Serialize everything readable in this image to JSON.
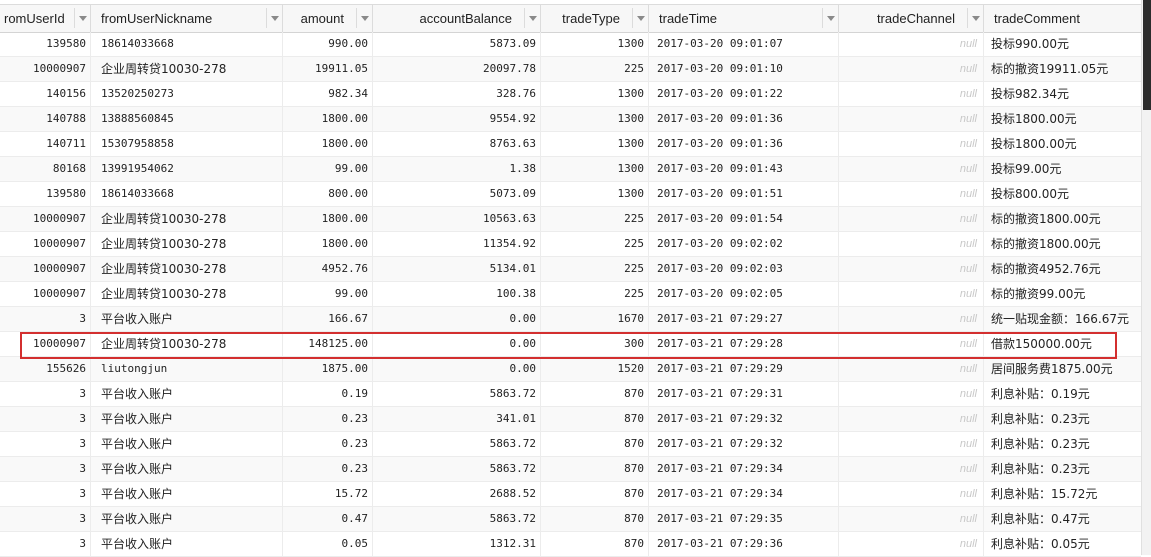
{
  "columns": [
    {
      "key": "fromUserId",
      "label": "romUserId"
    },
    {
      "key": "fromUserNickname",
      "label": "fromUserNickname"
    },
    {
      "key": "amount",
      "label": "amount"
    },
    {
      "key": "accountBalance",
      "label": "accountBalance"
    },
    {
      "key": "tradeType",
      "label": "tradeType"
    },
    {
      "key": "tradeTime",
      "label": "tradeTime"
    },
    {
      "key": "tradeChannel",
      "label": "tradeChannel"
    },
    {
      "key": "tradeComment",
      "label": "tradeComment"
    }
  ],
  "rows": [
    [
      "139580",
      "18614033668",
      "990.00",
      "5873.09",
      "1300",
      "2017-03-20 09:01:07",
      "null",
      "投标990.00元"
    ],
    [
      "10000907",
      "企业周转贷10030-278",
      "19911.05",
      "20097.78",
      "225",
      "2017-03-20 09:01:10",
      "null",
      "标的撤资19911.05元"
    ],
    [
      "140156",
      "13520250273",
      "982.34",
      "328.76",
      "1300",
      "2017-03-20 09:01:22",
      "null",
      "投标982.34元"
    ],
    [
      "140788",
      "13888560845",
      "1800.00",
      "9554.92",
      "1300",
      "2017-03-20 09:01:36",
      "null",
      "投标1800.00元"
    ],
    [
      "140711",
      "15307958858",
      "1800.00",
      "8763.63",
      "1300",
      "2017-03-20 09:01:36",
      "null",
      "投标1800.00元"
    ],
    [
      "80168",
      "13991954062",
      "99.00",
      "1.38",
      "1300",
      "2017-03-20 09:01:43",
      "null",
      "投标99.00元"
    ],
    [
      "139580",
      "18614033668",
      "800.00",
      "5073.09",
      "1300",
      "2017-03-20 09:01:51",
      "null",
      "投标800.00元"
    ],
    [
      "10000907",
      "企业周转贷10030-278",
      "1800.00",
      "10563.63",
      "225",
      "2017-03-20 09:01:54",
      "null",
      "标的撤资1800.00元"
    ],
    [
      "10000907",
      "企业周转贷10030-278",
      "1800.00",
      "11354.92",
      "225",
      "2017-03-20 09:02:02",
      "null",
      "标的撤资1800.00元"
    ],
    [
      "10000907",
      "企业周转贷10030-278",
      "4952.76",
      "5134.01",
      "225",
      "2017-03-20 09:02:03",
      "null",
      "标的撤资4952.76元"
    ],
    [
      "10000907",
      "企业周转贷10030-278",
      "99.00",
      "100.38",
      "225",
      "2017-03-20 09:02:05",
      "null",
      "标的撤资99.00元"
    ],
    [
      "3",
      "平台收入账户",
      "166.67",
      "0.00",
      "1670",
      "2017-03-21 07:29:27",
      "null",
      "统一贴现金额：166.67元"
    ],
    [
      "10000907",
      "企业周转贷10030-278",
      "148125.00",
      "0.00",
      "300",
      "2017-03-21 07:29:28",
      "null",
      "借款150000.00元"
    ],
    [
      "155626",
      "liutongjun",
      "1875.00",
      "0.00",
      "1520",
      "2017-03-21 07:29:29",
      "null",
      "居间服务费1875.00元"
    ],
    [
      "3",
      "平台收入账户",
      "0.19",
      "5863.72",
      "870",
      "2017-03-21 07:29:31",
      "null",
      "利息补贴：0.19元"
    ],
    [
      "3",
      "平台收入账户",
      "0.23",
      "341.01",
      "870",
      "2017-03-21 07:29:32",
      "null",
      "利息补贴：0.23元"
    ],
    [
      "3",
      "平台收入账户",
      "0.23",
      "5863.72",
      "870",
      "2017-03-21 07:29:32",
      "null",
      "利息补贴：0.23元"
    ],
    [
      "3",
      "平台收入账户",
      "0.23",
      "5863.72",
      "870",
      "2017-03-21 07:29:34",
      "null",
      "利息补贴：0.23元"
    ],
    [
      "3",
      "平台收入账户",
      "15.72",
      "2688.52",
      "870",
      "2017-03-21 07:29:34",
      "null",
      "利息补贴：15.72元"
    ],
    [
      "3",
      "平台收入账户",
      "0.47",
      "5863.72",
      "870",
      "2017-03-21 07:29:35",
      "null",
      "利息补贴：0.47元"
    ],
    [
      "3",
      "平台收入账户",
      "0.05",
      "1312.31",
      "870",
      "2017-03-21 07:29:36",
      "null",
      "利息补贴：0.05元"
    ]
  ],
  "highlighted_row": 12,
  "colors": {
    "highlight_border": "#d32f2f",
    "null_text": "#c8c8c8",
    "header_bg": "#f7f7f7",
    "scroll_thumb": "#2c2c2c"
  }
}
